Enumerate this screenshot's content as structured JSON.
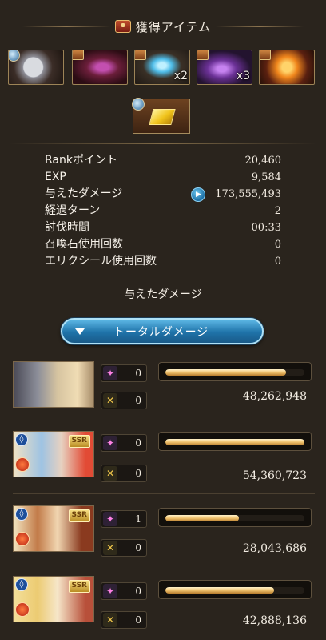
{
  "header": {
    "title": "獲得アイテム",
    "icon": "treasure-chest-icon"
  },
  "items": [
    {
      "name": "loot-item-1",
      "quantity": "",
      "colors": [
        "#3b2d27",
        "#c7c9cc"
      ]
    },
    {
      "name": "loot-item-2",
      "quantity": "",
      "colors": [
        "#5a1f20",
        "#b53aa0"
      ]
    },
    {
      "name": "loot-item-3",
      "quantity": "x2",
      "colors": [
        "#3b3227",
        "#57c8f0"
      ]
    },
    {
      "name": "loot-item-4",
      "quantity": "x3",
      "colors": [
        "#2b1d35",
        "#a658d6"
      ]
    },
    {
      "name": "loot-item-5",
      "quantity": "",
      "colors": [
        "#3a1a10",
        "#f28a1a"
      ]
    }
  ],
  "bonus_item": {
    "name": "gold-bar-item",
    "quantity": ""
  },
  "stats": [
    {
      "label": "Rankポイント",
      "value": "20,460"
    },
    {
      "label": "EXP",
      "value": "9,584"
    },
    {
      "label": "与えたダメージ",
      "value": "173,555,493",
      "has_play": true
    },
    {
      "label": "経過ターン",
      "value": "2"
    },
    {
      "label": "討伐時間",
      "value": "00:33"
    },
    {
      "label": "召喚石使用回数",
      "value": "0"
    },
    {
      "label": "エリクシール使用回数",
      "value": "0"
    }
  ],
  "damage_section": {
    "title": "与えたダメージ",
    "toggle_label": "トータルダメージ"
  },
  "party": [
    {
      "ssr": "",
      "icons": false,
      "ougi": "0",
      "chain": "0",
      "gauge_percent": 87,
      "damage": "48,262,948",
      "colors": [
        "#8e8f98",
        "#e7cfa2"
      ]
    },
    {
      "ssr": "SSR",
      "icons": true,
      "ougi": "0",
      "chain": "0",
      "gauge_percent": 100,
      "damage": "54,360,723",
      "colors": [
        "#8cbde0",
        "#e04e3c"
      ]
    },
    {
      "ssr": "SSR",
      "icons": true,
      "ougi": "1",
      "chain": "0",
      "gauge_percent": 53,
      "damage": "28,043,686",
      "colors": [
        "#c27b49",
        "#f1d6b1"
      ]
    },
    {
      "ssr": "SSR",
      "icons": true,
      "ougi": "0",
      "chain": "0",
      "gauge_percent": 78,
      "damage": "42,888,136",
      "colors": [
        "#eccb72",
        "#f6e6c9"
      ]
    }
  ]
}
